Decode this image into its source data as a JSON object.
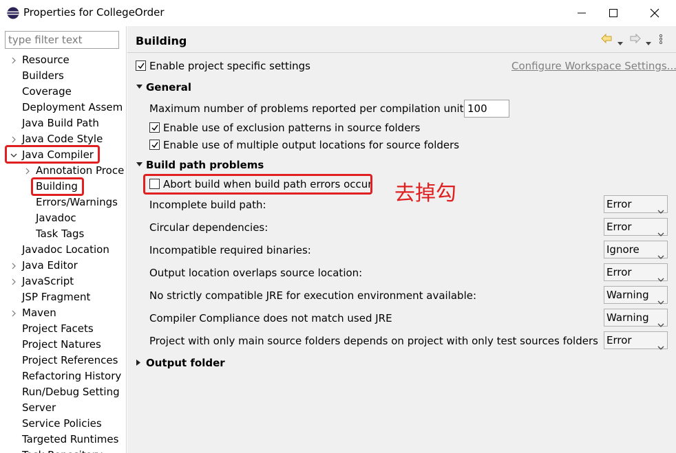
{
  "window": {
    "title": "Properties for CollegeOrder"
  },
  "filter": {
    "placeholder": "type filter text"
  },
  "tree": {
    "items": [
      {
        "label": "Resource",
        "twisty": true
      },
      {
        "label": "Builders",
        "twisty": false
      },
      {
        "label": "Coverage",
        "twisty": false
      },
      {
        "label": "Deployment Assem",
        "twisty": false
      },
      {
        "label": "Java Build Path",
        "twisty": false
      },
      {
        "label": "Java Code Style",
        "twisty": true
      },
      {
        "label": "Java Compiler",
        "twisty": true,
        "expanded": true
      },
      {
        "label": "Annotation Proce",
        "twisty": true
      },
      {
        "label": "Building",
        "twisty": false
      },
      {
        "label": "Errors/Warnings",
        "twisty": false
      },
      {
        "label": "Javadoc",
        "twisty": false
      },
      {
        "label": "Task Tags",
        "twisty": false
      },
      {
        "label": "Javadoc Location",
        "twisty": false
      },
      {
        "label": "Java Editor",
        "twisty": true
      },
      {
        "label": "JavaScript",
        "twisty": true
      },
      {
        "label": "JSP Fragment",
        "twisty": false
      },
      {
        "label": "Maven",
        "twisty": true
      },
      {
        "label": "Project Facets",
        "twisty": false
      },
      {
        "label": "Project Natures",
        "twisty": false
      },
      {
        "label": "Project References",
        "twisty": false
      },
      {
        "label": "Refactoring History",
        "twisty": false
      },
      {
        "label": "Run/Debug Setting",
        "twisty": false
      },
      {
        "label": "Server",
        "twisty": false
      },
      {
        "label": "Service Policies",
        "twisty": false
      },
      {
        "label": "Targeted Runtimes",
        "twisty": false
      },
      {
        "label": "Task Repository",
        "twisty": false
      }
    ]
  },
  "page": {
    "title": "Building",
    "enable_specific": "Enable project specific settings",
    "configure_link": "Configure Workspace Settings...",
    "general": {
      "title": "General",
      "max_problems_label": "Maximum number of problems reported per compilation unit:",
      "max_problems_value": "100",
      "exclusion_patterns": "Enable use of exclusion patterns in source folders",
      "multiple_outputs": "Enable use of multiple output locations for source folders"
    },
    "build_path": {
      "title": "Build path problems",
      "abort_build": "Abort build when build path errors occur",
      "rows": [
        {
          "label": "Incomplete build path:",
          "value": "Error"
        },
        {
          "label": "Circular dependencies:",
          "value": "Error"
        },
        {
          "label": "Incompatible required binaries:",
          "value": "Ignore"
        },
        {
          "label": "Output location overlaps source location:",
          "value": "Error"
        },
        {
          "label": "No strictly compatible JRE for execution environment available:",
          "value": "Warning"
        },
        {
          "label": "Compiler Compliance does not match used JRE",
          "value": "Warning"
        },
        {
          "label": "Project with only main source folders depends on project with only test sources folders",
          "value": "Error"
        }
      ]
    },
    "output_folder": {
      "title": "Output folder"
    }
  },
  "annotation": {
    "text": "去掉勾",
    "color": "#e02020"
  },
  "icons": {
    "app": "eclipse-icon",
    "back": "back-arrow-icon",
    "forward": "forward-arrow-icon",
    "menu": "view-menu-icon"
  }
}
